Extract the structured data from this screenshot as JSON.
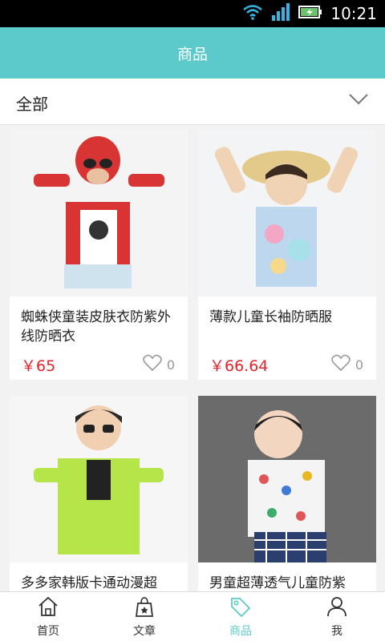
{
  "status_bar": {
    "time": "10:21"
  },
  "header": {
    "title": "商品"
  },
  "filter": {
    "label": "全部"
  },
  "products": [
    {
      "title": "蜘蛛侠童装皮肤衣防紫外线防晒衣",
      "price": "￥65",
      "likes": "0"
    },
    {
      "title": "薄款儿童长袖防晒服",
      "price": "￥66.64",
      "likes": "0"
    },
    {
      "title": "多多家韩版卡通动漫超",
      "price": "",
      "likes": ""
    },
    {
      "title": "男童超薄透气儿童防紫",
      "price": "",
      "likes": ""
    }
  ],
  "nav": {
    "items": [
      {
        "label": "首页",
        "icon": "home-icon"
      },
      {
        "label": "文章",
        "icon": "bag-icon"
      },
      {
        "label": "商品",
        "icon": "tag-icon"
      },
      {
        "label": "我",
        "icon": "user-icon"
      }
    ],
    "active": 2
  },
  "colors": {
    "accent": "#5ccacb",
    "price": "#e3242b"
  }
}
